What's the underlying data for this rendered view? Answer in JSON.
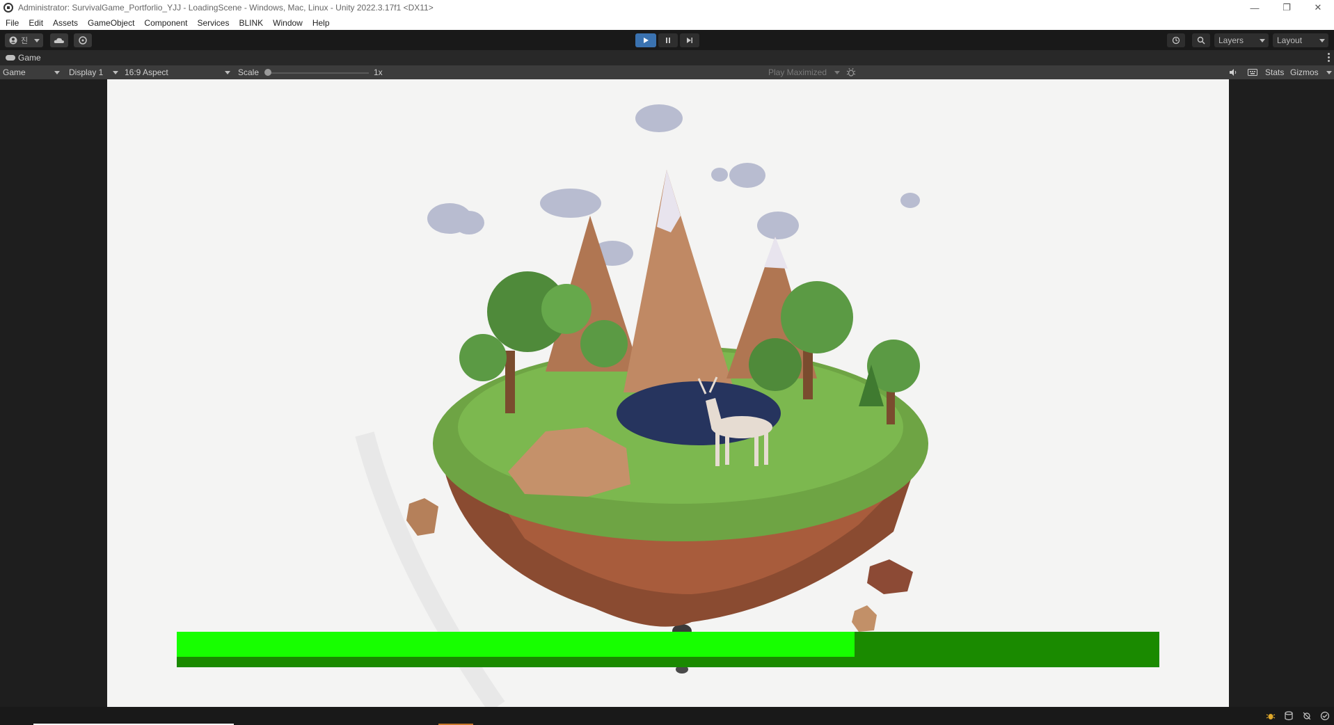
{
  "window": {
    "title": "Administrator: SurvivalGame_Portforlio_YJJ - LoadingScene - Windows, Mac, Linux - Unity 2022.3.17f1 <DX11>",
    "minimize": "—",
    "restore": "❐",
    "close": "✕"
  },
  "menu": [
    "File",
    "Edit",
    "Assets",
    "GameObject",
    "Component",
    "Services",
    "BLINK",
    "Window",
    "Help"
  ],
  "toolbar": {
    "account_label": "진",
    "layers_label": "Layers",
    "layout_label": "Layout"
  },
  "game_tab": {
    "label": "Game"
  },
  "game_view": {
    "mode_label": "Game",
    "display_label": "Display 1",
    "aspect_label": "16:9 Aspect",
    "scale_label": "Scale",
    "scale_value": "1x",
    "play_mode_label": "Play Maximized",
    "stats_label": "Stats",
    "gizmos_label": "Gizmos"
  },
  "loading": {
    "progress": 0.69
  },
  "colors": {
    "accent_blue": "#3a72b0",
    "loading_fill": "#17ff00",
    "loading_track": "#1a8a00",
    "viewport_bg": "#f4f4f3"
  }
}
